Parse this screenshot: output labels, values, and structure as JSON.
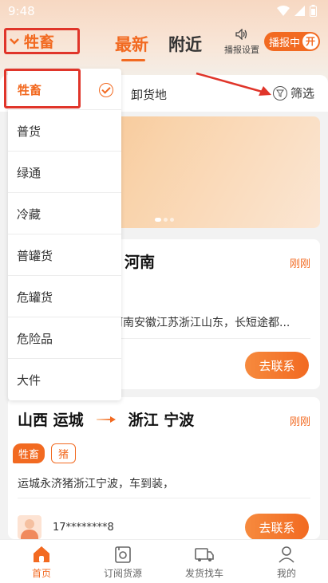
{
  "status_bar": {
    "time": "9:48"
  },
  "header": {
    "category_selected": "牲畜",
    "tabs": [
      {
        "label": "最新",
        "active": true
      },
      {
        "label": "附近",
        "active": false
      }
    ],
    "broadcast_settings_label": "播报设置",
    "broadcast_label": "播报中",
    "broadcast_state": "开"
  },
  "filter_bar": {
    "unload_label": "卸货地",
    "filter_label": "筛选"
  },
  "dropdown": {
    "items": [
      {
        "label": "牲畜",
        "selected": true
      },
      {
        "label": "普货"
      },
      {
        "label": "绿通"
      },
      {
        "label": "冷藏"
      },
      {
        "label": "普罐货"
      },
      {
        "label": "危罐货"
      },
      {
        "label": "危险品"
      },
      {
        "label": "大件"
      }
    ]
  },
  "cards": [
    {
      "destination": "河南",
      "time": "刚刚",
      "description": "河南安徽江苏浙江山东，长短途都...",
      "contact_label": "去联系"
    },
    {
      "origin": "山西 运城",
      "destination": "浙江 宁波",
      "time": "刚刚",
      "tags": [
        "牲畜",
        "猪"
      ],
      "description": "运城永济猪浙江宁波，车到装，",
      "phone": "17********8",
      "contact_label": "去联系"
    }
  ],
  "tab_bar": {
    "items": [
      {
        "label": "首页",
        "active": true
      },
      {
        "label": "订阅货源"
      },
      {
        "label": "发货找车"
      },
      {
        "label": "我的"
      }
    ]
  },
  "colors": {
    "accent": "#f26a21",
    "highlight": "#e0352a"
  }
}
